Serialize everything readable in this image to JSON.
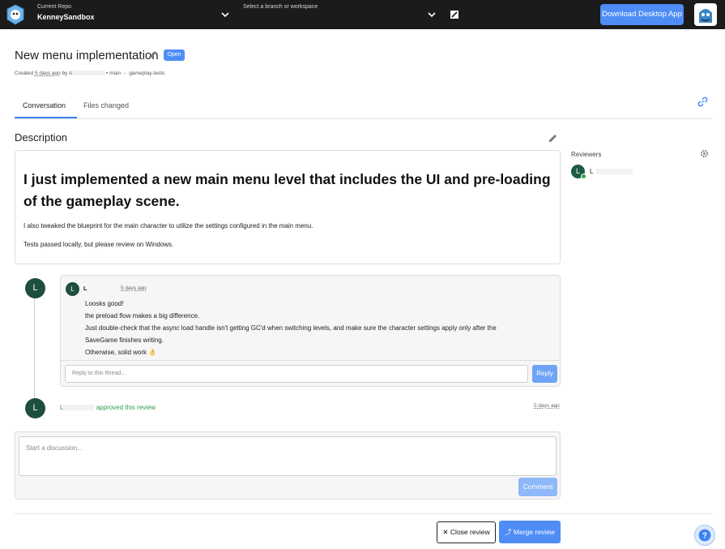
{
  "topbar": {
    "repo_label": "Current Repo",
    "repo_name": "KenneySandbox",
    "branch_label": "Select a branch or workspace",
    "download_label": "Download Desktop App"
  },
  "review": {
    "title": "New menu implementation",
    "status": "Open",
    "meta_created": "Created",
    "meta_time": "5 days ago",
    "meta_by": "by A",
    "meta_branches": "• main ← gameplay-tests"
  },
  "tabs": [
    {
      "label": "Conversation",
      "active": true
    },
    {
      "label": "Files changed",
      "active": false
    }
  ],
  "description": {
    "heading": "Description",
    "h1": "I just implemented a new main menu level that includes the UI and pre-loading of the gameplay scene.",
    "p1": "I also tweaked the blueprint for the main character to utilize the settings configured in the main menu.",
    "p2": "Tests passed locally, but please review on Windows."
  },
  "reviewers": {
    "heading": "Reviewers",
    "items": [
      {
        "initial": "L",
        "name": "L",
        "approved": true
      }
    ]
  },
  "comment": {
    "avatar_initial": "L",
    "author": "L",
    "time": "5 days ago",
    "lines": [
      "Loosks good!",
      "the preload flow makes a big difference.",
      "Just double-check that the async load handle isn't getting GC'd when switching levels, and make sure the character settings apply only after the",
      "SaveGame finishes writing.",
      "Otherwise, solid work 👌"
    ],
    "reply_placeholder": "Reply to this thread...",
    "reply_label": "Reply"
  },
  "approval": {
    "avatar_initial": "L",
    "name": "L",
    "text": "approved this review",
    "time": "5 days ago"
  },
  "discussion": {
    "placeholder": "Start a discussion...",
    "comment_label": "Comment"
  },
  "actions": {
    "close_label": "Close review",
    "merge_label": "Merge review"
  },
  "colors": {
    "accent": "#4e8df5",
    "approved": "#2e9d4d",
    "avatar": "#1d4f3c",
    "topbar": "#1b1b1b"
  }
}
